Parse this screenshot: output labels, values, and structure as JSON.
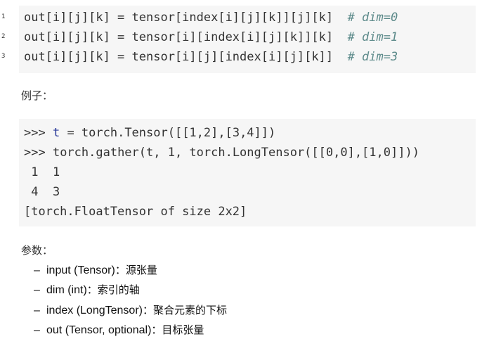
{
  "code_block_1": {
    "line_numbers": [
      "1",
      "2",
      "3"
    ],
    "lines": [
      {
        "code": "out[i][j][k] = tensor[index[i][j][k]][j][k]  ",
        "comment": "# dim=0"
      },
      {
        "code": "out[i][j][k] = tensor[i][index[i][j][k]][k]  ",
        "comment": "# dim=1"
      },
      {
        "code": "out[i][j][k] = tensor[i][j][index[i][j][k]]  ",
        "comment": "# dim=3"
      }
    ]
  },
  "example_heading": "例子：",
  "code_block_2": {
    "lines": [
      {
        "prompt": ">>> ",
        "var": "t",
        "rest": " = torch.Tensor([[1,2],[3,4]])"
      },
      {
        "prompt": ">>> ",
        "var": "",
        "rest": "torch.gather(t, 1, torch.LongTensor([[0,0],[1,0]]))"
      },
      {
        "prompt": "",
        "var": "",
        "rest": " 1  1"
      },
      {
        "prompt": "",
        "var": "",
        "rest": " 4  3"
      },
      {
        "prompt": "",
        "var": "",
        "rest": "[torch.FloatTensor of size 2x2]"
      }
    ]
  },
  "params_heading": "参数：",
  "params": [
    {
      "dash": "–",
      "name": "input (Tensor)",
      "desc": "：源张量"
    },
    {
      "dash": "–",
      "name": "dim (int)",
      "desc": "：索引的轴"
    },
    {
      "dash": "–",
      "name": "index (LongTensor)",
      "desc": "：聚合元素的下标"
    },
    {
      "dash": "–",
      "name": "out (Tensor, optional)",
      "desc": "：目标张量"
    }
  ]
}
